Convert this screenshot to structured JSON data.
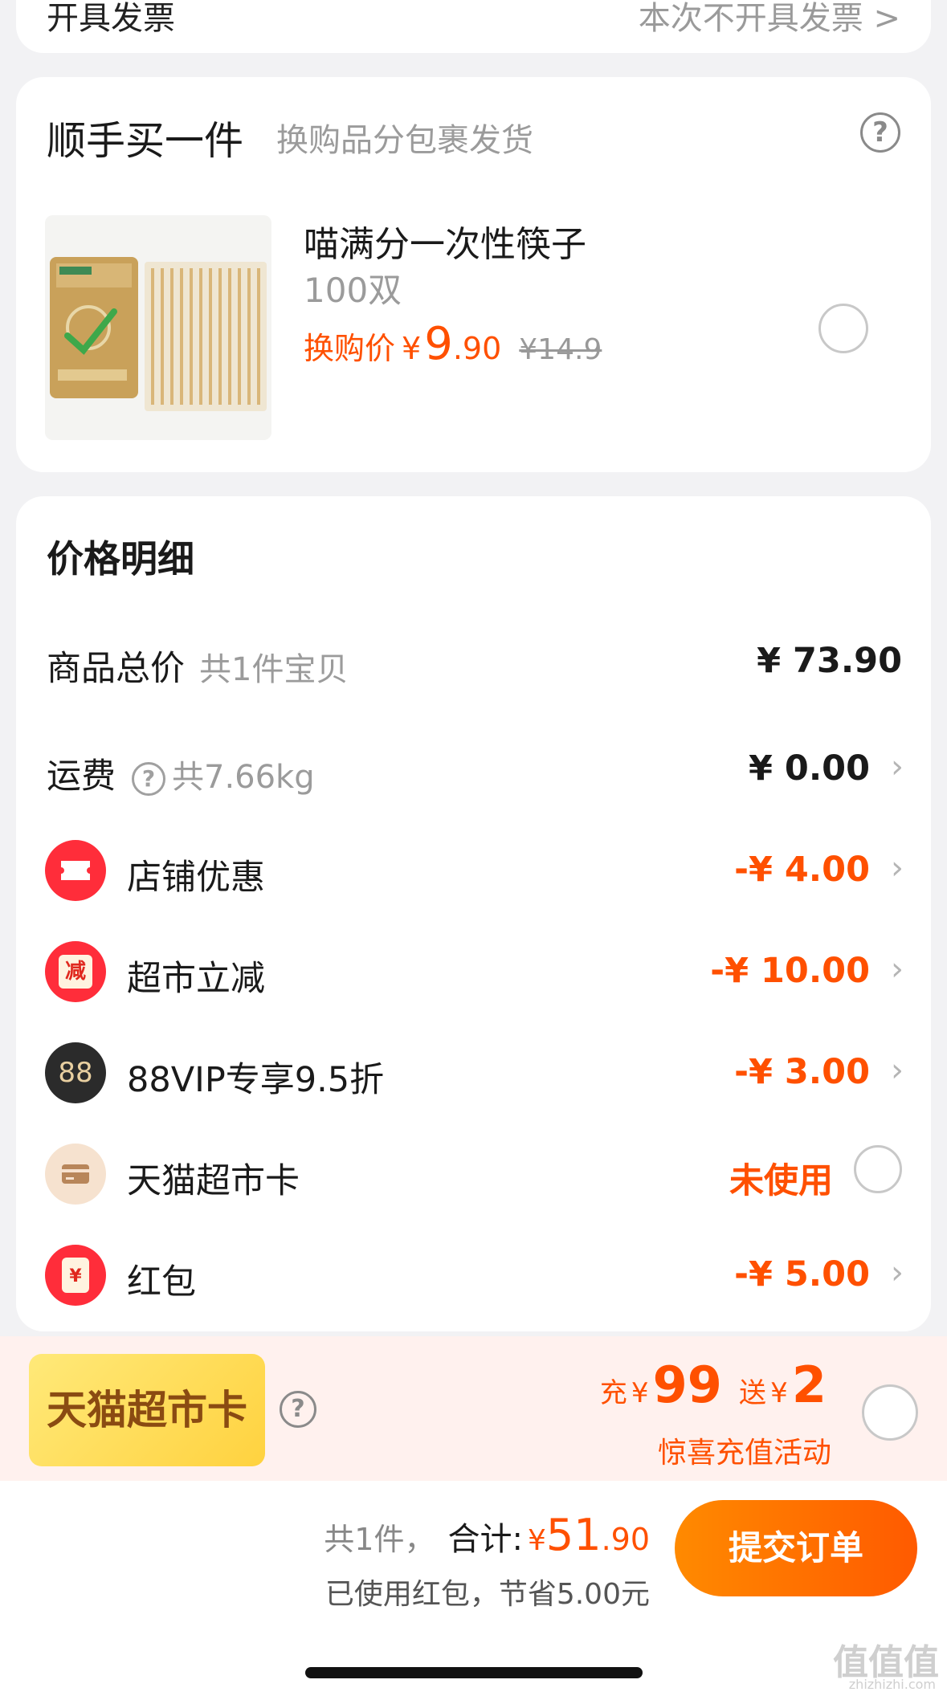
{
  "invoice": {
    "label": "开具发票",
    "value": "本次不开具发票 >"
  },
  "addon": {
    "title": "顺手买一件",
    "subtitle": "换购品分包裹发货",
    "help_icon": "question-circle-icon",
    "product": {
      "name": "喵满分一次性筷子",
      "spec": "100双",
      "price_label": "换购价",
      "currency": "¥",
      "price_int": "9",
      "price_dec": ".90",
      "original_price": "¥14.9"
    }
  },
  "price_details": {
    "title": "价格明细",
    "rows": [
      {
        "label": "商品总价",
        "sub": "共1件宝贝",
        "amount": "¥ 73.90"
      },
      {
        "label": "运费",
        "sub": "共7.66kg",
        "amount": "¥ 0.00"
      },
      {
        "label": "店铺优惠",
        "amount": "-¥ 4.00",
        "icon": "ticket-icon"
      },
      {
        "label": "超市立减",
        "amount": "-¥ 10.00",
        "icon": "discount-badge-icon",
        "icon_text": "减"
      },
      {
        "label": "88VIP专享9.5折",
        "amount": "-¥ 3.00",
        "icon": "88vip-icon",
        "icon_text": "88"
      },
      {
        "label": "天猫超市卡",
        "amount": "未使用",
        "icon": "card-icon"
      },
      {
        "label": "红包",
        "amount": "-¥ 5.00",
        "icon": "red-packet-icon",
        "icon_text": "¥"
      }
    ]
  },
  "promo": {
    "button": "天猫超市卡",
    "charge_label": "充",
    "charge_currency": "¥",
    "charge_amount": "99",
    "gift_label": "送",
    "gift_currency": "¥",
    "gift_amount": "2",
    "note": "惊喜充值活动"
  },
  "bottom": {
    "count": "共1件，",
    "total_label": "合计:",
    "currency": "¥",
    "total_int": "51",
    "total_dec": ".90",
    "saved": "已使用红包，节省5.00元",
    "submit": "提交订单"
  },
  "watermark": {
    "text": "值值值",
    "sub": "zhizhizhi.com"
  },
  "colors": {
    "accent": "#ff5000",
    "promo_bg": "#fff1ee",
    "card_gold": "#ffd23f"
  }
}
